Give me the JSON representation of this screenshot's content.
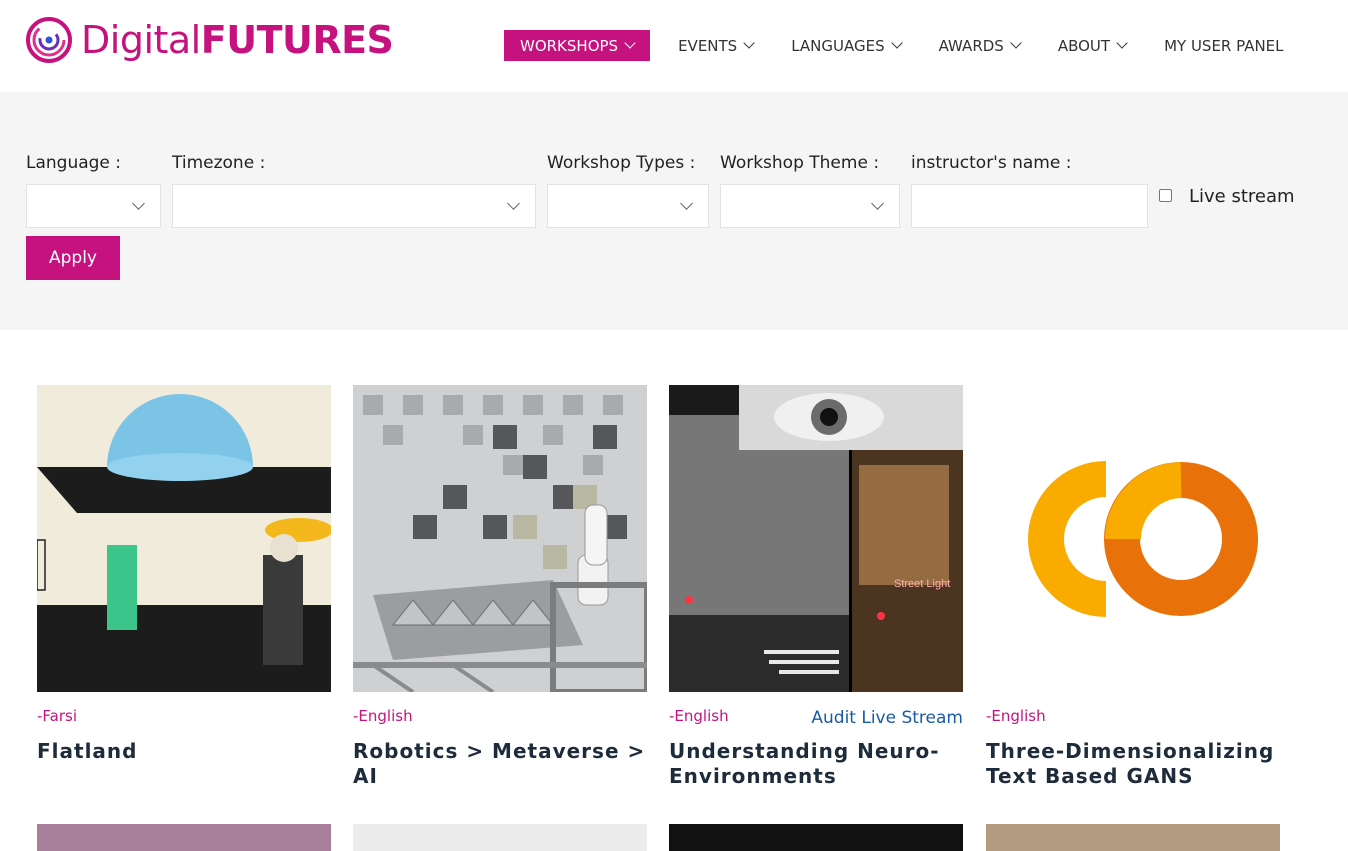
{
  "brand": {
    "name_part1": "Digital",
    "name_part2": "FUTURES",
    "accent": "#c6127f"
  },
  "nav": {
    "items": [
      {
        "label": "WORKSHOPS",
        "has_dropdown": true,
        "active": true
      },
      {
        "label": "EVENTS",
        "has_dropdown": true
      },
      {
        "label": "LANGUAGES",
        "has_dropdown": true
      },
      {
        "label": "AWARDS",
        "has_dropdown": true
      },
      {
        "label": "ABOUT",
        "has_dropdown": true
      },
      {
        "label": "MY USER PANEL",
        "has_dropdown": false
      }
    ]
  },
  "filters": {
    "language_label": "Language :",
    "timezone_label": "Timezone :",
    "types_label": "Workshop Types :",
    "theme_label": "Workshop Theme :",
    "instructor_label": "instructor's name :",
    "live_stream_label": "Live stream",
    "live_stream_checked": false,
    "apply_label": "Apply"
  },
  "workshops": [
    {
      "language": "-Farsi",
      "title": "Flatland",
      "icon": "flatland-collage-image"
    },
    {
      "language": "-English",
      "title": "Robotics > Metaverse > AI",
      "icon": "robot-arm-wall-image"
    },
    {
      "language": "-English",
      "title": "Understanding Neuro-Environments",
      "live_link": "Audit Live Stream",
      "icon": "eye-street-night-image"
    },
    {
      "language": "-English",
      "title": "Three-Dimensionalizing Text Based GANS",
      "icon": "colab-logo-image"
    }
  ],
  "thumb_texts": {
    "street_light": "Street Light"
  }
}
